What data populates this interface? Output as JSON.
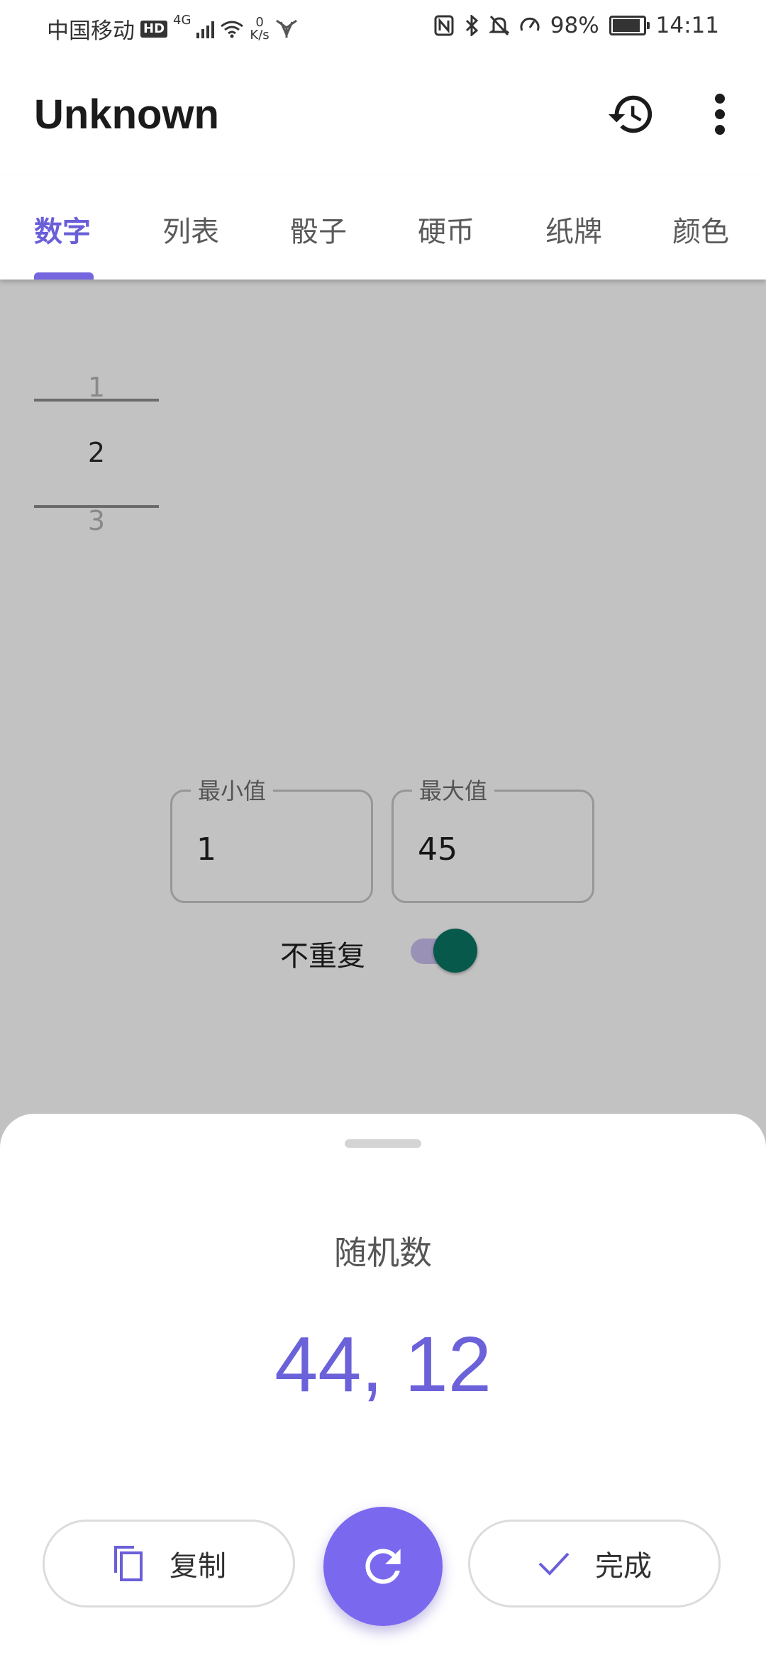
{
  "status_bar": {
    "carrier": "中国移动",
    "hd": "HD",
    "network": "4G",
    "speed_value": "0",
    "speed_unit": "K/s",
    "battery": "98%",
    "time": "14:11"
  },
  "app_bar": {
    "title": "Unknown",
    "icons": [
      "history-icon",
      "more-vert-icon"
    ]
  },
  "tabs": [
    {
      "label": "数字",
      "active": true
    },
    {
      "label": "列表",
      "active": false
    },
    {
      "label": "骰子",
      "active": false
    },
    {
      "label": "硬币",
      "active": false
    },
    {
      "label": "纸牌",
      "active": false
    },
    {
      "label": "颜色",
      "active": false
    }
  ],
  "picker": {
    "prev": "1",
    "current": "2",
    "next": "3"
  },
  "fields": {
    "min": {
      "label": "最小值",
      "value": "1"
    },
    "max": {
      "label": "最大值",
      "value": "45"
    }
  },
  "toggle": {
    "label": "不重复",
    "on": true
  },
  "sheet": {
    "title": "随机数",
    "result": "44, 12",
    "copy_label": "复制",
    "done_label": "完成",
    "refresh_icon": "refresh-icon"
  },
  "colors": {
    "accent": "#7566e0",
    "toggle_thumb": "#0a7565",
    "fab": "#7a68ef"
  }
}
